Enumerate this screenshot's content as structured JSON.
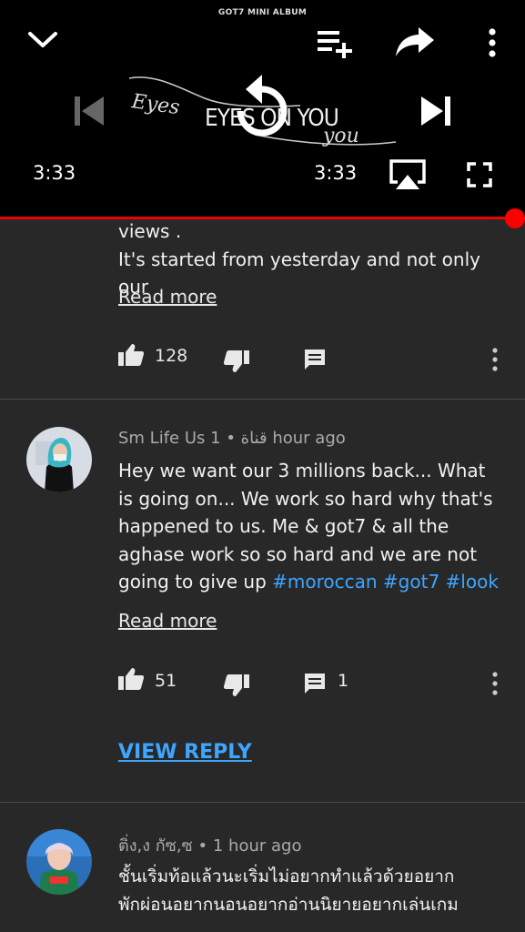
{
  "player": {
    "video_title": "GOT7 MINI ALBUM",
    "artwork_text_script_1": "Eyes",
    "artwork_text_main": "EYES ON YOU",
    "artwork_text_script_2": "you",
    "current_time": "3:33",
    "duration": "3:33",
    "progress_fraction": 1.0,
    "accent_color": "#ff0000"
  },
  "icons": {
    "collapse": "chevron-down-icon",
    "add_to_playlist": "playlist-add-icon",
    "share": "share-icon",
    "more": "more-vertical-icon",
    "previous": "skip-previous-icon",
    "replay": "replay-icon",
    "next": "skip-next-icon",
    "cast": "airplay-icon",
    "fullscreen": "fullscreen-icon",
    "like": "thumb-up-icon",
    "dislike": "thumb-down-icon",
    "reply": "comment-icon"
  },
  "comments": [
    {
      "text_lines": [
        "views .",
        "It's started from yesterday and not only our"
      ],
      "read_more": "Read more",
      "likes": "128"
    },
    {
      "author": "Sm Life Us قناة",
      "separator": "•",
      "time": "1 hour ago",
      "text": "Hey we want our 3 millions back... What is going on... We work so hard why that's happened to us. Me & got7 & all the aghase work so so hard and we are not going to give up ",
      "hashtags": [
        "#moroccan",
        "#got7",
        "#look"
      ],
      "read_more": "Read more",
      "likes": "51",
      "replies": "1",
      "view_reply": "VIEW REPLY"
    },
    {
      "author": "ติ่ง,ง กัซ,ซ",
      "separator": "•",
      "time": "1 hour ago",
      "text_lines": [
        "ชั้นเริ่มท้อแล้วนะเริ่มไม่อยากทำแล้วด้วยอยาก",
        "พักผ่อนอยากนอนอยากอ่านนิยายอยากเล่นเกม"
      ]
    }
  ]
}
